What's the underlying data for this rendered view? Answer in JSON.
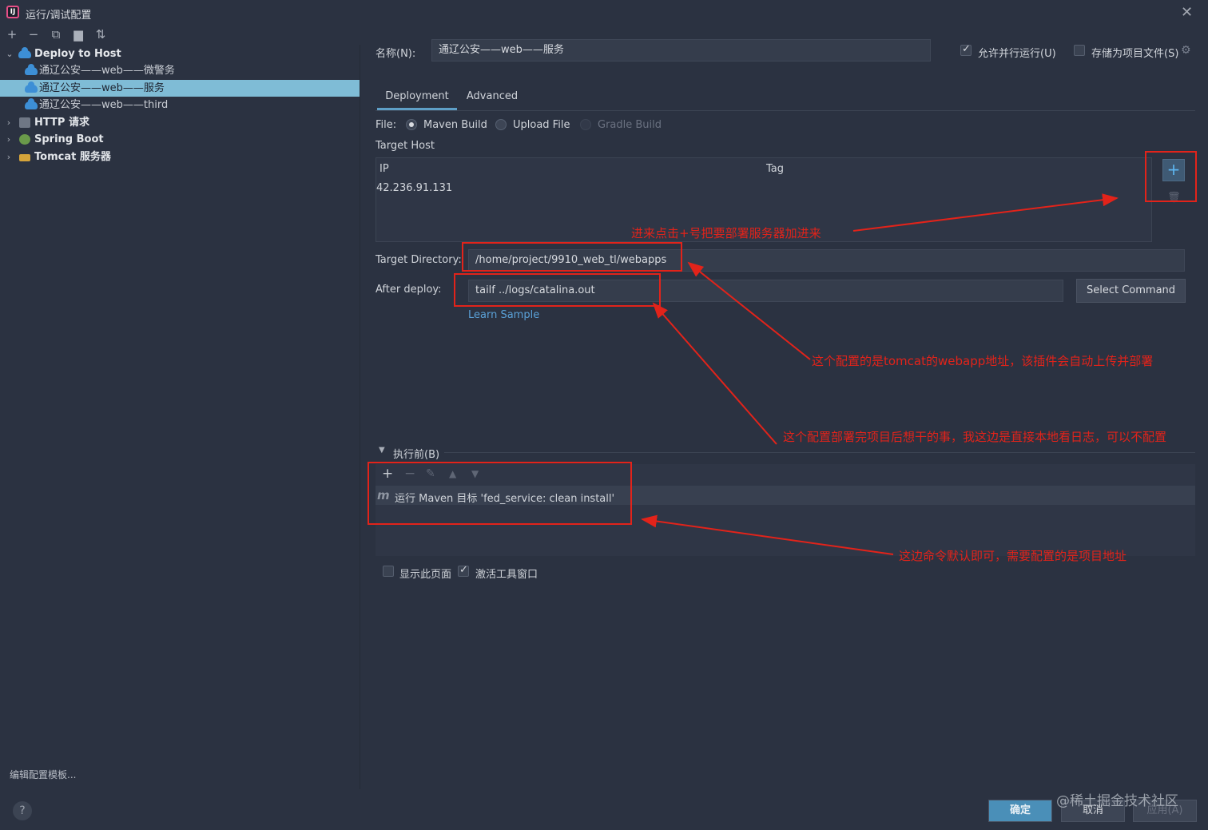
{
  "window": {
    "title": "运行/调试配置"
  },
  "sidebar": {
    "tree": [
      {
        "label": "Deploy to Host",
        "expanded": true,
        "bold": true
      },
      {
        "label": "通辽公安——web——微警务"
      },
      {
        "label": "通辽公安——web——服务",
        "selected": true
      },
      {
        "label": "通辽公安——web——third"
      },
      {
        "label": "HTTP 请求",
        "bold": true
      },
      {
        "label": "Spring Boot",
        "bold": true
      },
      {
        "label": "Tomcat 服务器",
        "bold": true
      }
    ],
    "edit_templates": "编辑配置模板..."
  },
  "header": {
    "name_label": "名称(N):",
    "name_value": "通辽公安——web——服务",
    "allow_parallel": "允许并行运行(U)",
    "store_as_file": "存储为项目文件(S)"
  },
  "tabs": [
    {
      "label": "Deployment",
      "active": true
    },
    {
      "label": "Advanced"
    }
  ],
  "file": {
    "label": "File:",
    "options": [
      "Maven Build",
      "Upload File",
      "Gradle Build"
    ],
    "selected": "Maven Build"
  },
  "target_host": {
    "label": "Target Host",
    "columns": [
      "IP",
      "Tag"
    ],
    "rows": [
      [
        "42.236.91.131",
        ""
      ]
    ]
  },
  "target_directory": {
    "label": "Target Directory:",
    "value": "/home/project/9910_web_tl/webapps"
  },
  "after_deploy": {
    "label": "After deploy:",
    "value": "tailf ../logs/catalina.out",
    "select_command": "Select Command",
    "learn_sample": "Learn Sample"
  },
  "before_launch": {
    "header": "执行前(B)",
    "items": [
      "运行 Maven 目标 'fed_service: clean install'"
    ],
    "show_page": "显示此页面",
    "activate_tool": "激活工具窗口"
  },
  "annotations": {
    "a1": "进来点击+号把要部署服务器加进来",
    "a2": "这个配置的是tomcat的webapp地址，该插件会自动上传并部署",
    "a3": "这个配置部署完项目后想干的事，我这边是直接本地看日志，可以不配置",
    "a4": "这边命令默认即可，需要配置的是项目地址"
  },
  "footer": {
    "ok": "确定",
    "cancel": "取消",
    "apply": "应用(A)",
    "watermark": "@稀土掘金技术社区"
  }
}
